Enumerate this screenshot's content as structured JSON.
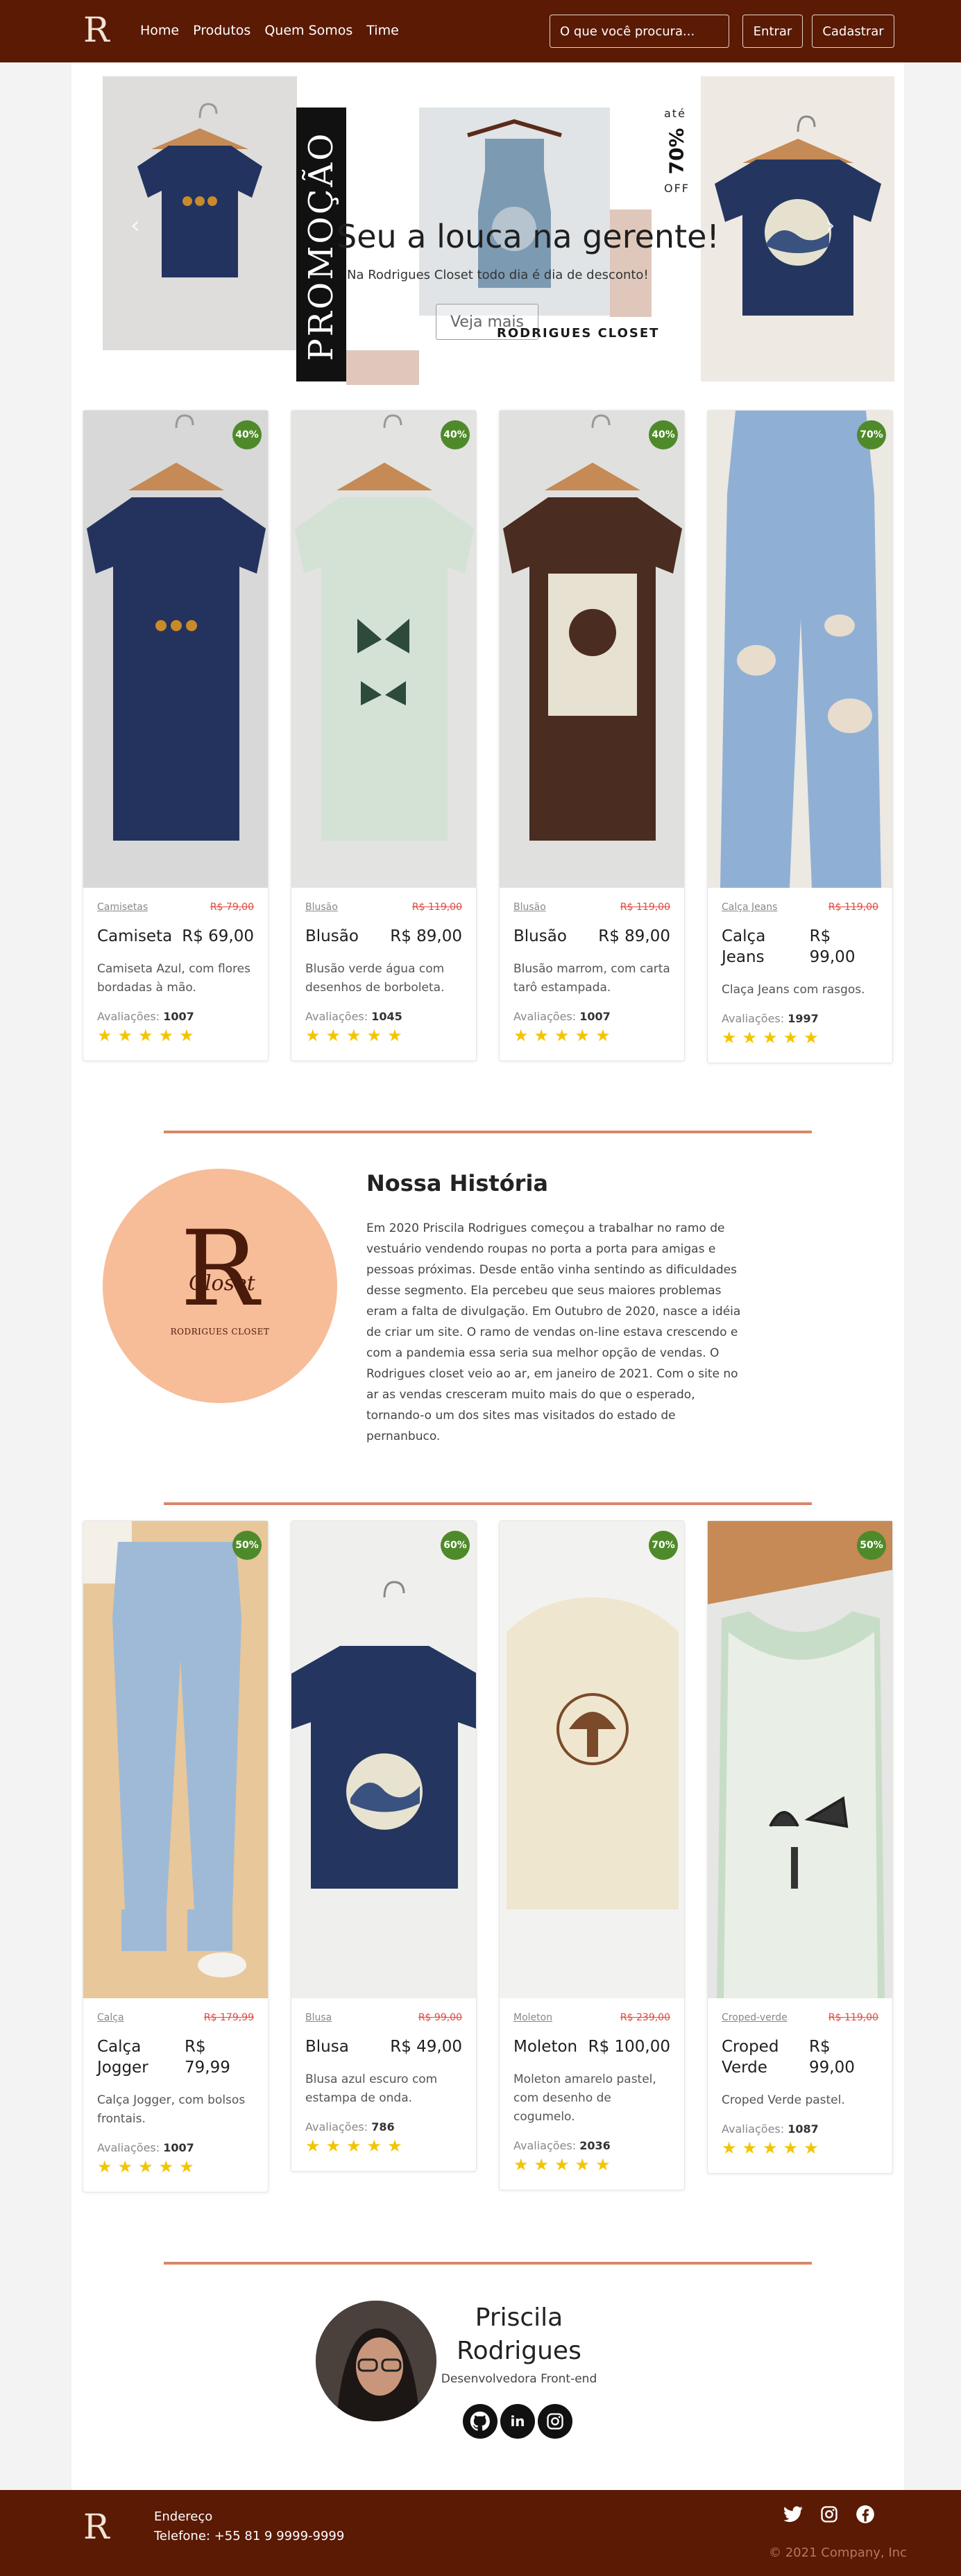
{
  "nav": {
    "logo_letter": "R",
    "links": [
      "Home",
      "Produtos",
      "Quem Somos",
      "Time"
    ],
    "search_placeholder": "O que você procura...",
    "login_label": "Entrar",
    "signup_label": "Cadastrar"
  },
  "hero": {
    "promo_label": "PROMOÇÃO",
    "title": "Seu a louca na gerente!",
    "subtitle": "Na Rodrigues Closet todo dia é dia de desconto!",
    "button_label": "Veja mais",
    "brand_label": "RODRIGUES CLOSET",
    "discount_prefix": "até",
    "discount_value": "70%",
    "discount_suffix": "OFF",
    "prev_arrow": "chevron-left-icon",
    "next_arrow": "chevron-right-icon"
  },
  "products_top": [
    {
      "badge": "40%",
      "category": "Camisetas",
      "old_price": "R$ 79,00",
      "name": "Camiseta",
      "price": "R$ 69,00",
      "description": "Camiseta Azul, com flores bordadas à mão.",
      "reviews_label": "Avaliações:",
      "reviews": "1007",
      "rating": 5
    },
    {
      "badge": "40%",
      "category": "Blusão",
      "old_price": "R$ 119,00",
      "name": "Blusão",
      "price": "R$ 89,00",
      "description": "Blusão verde água com desenhos de borboleta.",
      "reviews_label": "Avaliações:",
      "reviews": "1045",
      "rating": 5
    },
    {
      "badge": "40%",
      "category": "Blusão",
      "old_price": "R$ 119,00",
      "name": "Blusão",
      "price": "R$ 89,00",
      "description": "Blusão marrom, com carta tarô estampada.",
      "reviews_label": "Avaliações:",
      "reviews": "1007",
      "rating": 5
    },
    {
      "badge": "70%",
      "category": "Calça Jeans",
      "old_price": "R$ 119,00",
      "name": "Calça Jeans",
      "price": "R$ 99,00",
      "description": "Claça Jeans com rasgos.",
      "reviews_label": "Avaliações:",
      "reviews": "1997",
      "rating": 5
    }
  ],
  "history": {
    "logo_script": "Closet",
    "logo_sub": "RODRIGUES CLOSET",
    "title": "Nossa História",
    "text": "Em 2020 Priscila Rodrigues começou a trabalhar no ramo de vestuário vendendo roupas no porta a porta para amigas e pessoas próximas. Desde então vinha sentindo as dificuldades desse segmento. Ela percebeu que seus maiores problemas eram a falta de divulgação. Em Outubro de 2020, nasce a idéia de criar um site. O ramo de vendas on-line estava crescendo e com a pandemia essa seria sua melhor opção de vendas. O Rodrigues closet veio ao ar, em janeiro de 2021. Com o site no ar as vendas cresceram muito mais do que o esperado, tornando-o um dos sites mas visitados do estado de pernanbuco."
  },
  "products_bottom": [
    {
      "badge": "50%",
      "category": "Calça",
      "old_price": "R$ 179,99",
      "name": "Calça Jogger",
      "price": "R$ 79,99",
      "description": "Calça Jogger, com bolsos frontais.",
      "reviews_label": "Avaliações:",
      "reviews": "1007",
      "rating": 5
    },
    {
      "badge": "60%",
      "category": "Blusa",
      "old_price": "R$ 99,00",
      "name": "Blusa",
      "price": "R$ 49,00",
      "description": "Blusa azul escuro com estampa de onda.",
      "reviews_label": "Avaliações:",
      "reviews": "786",
      "rating": 5
    },
    {
      "badge": "70%",
      "category": "Moleton",
      "old_price": "R$ 239,00",
      "name": "Moleton",
      "price": "R$ 100,00",
      "description": "Moleton amarelo pastel, com desenho de cogumelo.",
      "reviews_label": "Avaliações:",
      "reviews": "2036",
      "rating": 5
    },
    {
      "badge": "50%",
      "category": "Croped-verde",
      "old_price": "R$ 119,00",
      "name": "Croped Verde",
      "price": "R$ 99,00",
      "description": "Croped Verde pastel.",
      "reviews_label": "Avaliações:",
      "reviews": "1087",
      "rating": 5
    }
  ],
  "profile": {
    "name": "Priscila Rodrigues",
    "role": "Desenvolvedora Front-end",
    "icons": [
      "github-icon",
      "linkedin-icon",
      "instagram-icon"
    ]
  },
  "footer": {
    "address_label": "Endereço",
    "phone": "Telefone: +55 81 9 9999-9999",
    "social_icons": [
      "twitter-icon",
      "instagram-icon",
      "facebook-icon"
    ],
    "copyright": "© 2021 Company, Inc"
  },
  "colors": {
    "brand_brown": "#5a1a04",
    "accent_peach": "#f7bc98",
    "badge_green": "#4f8a2a",
    "old_price_red": "#e04a3d",
    "star_yellow": "#f2c500"
  }
}
